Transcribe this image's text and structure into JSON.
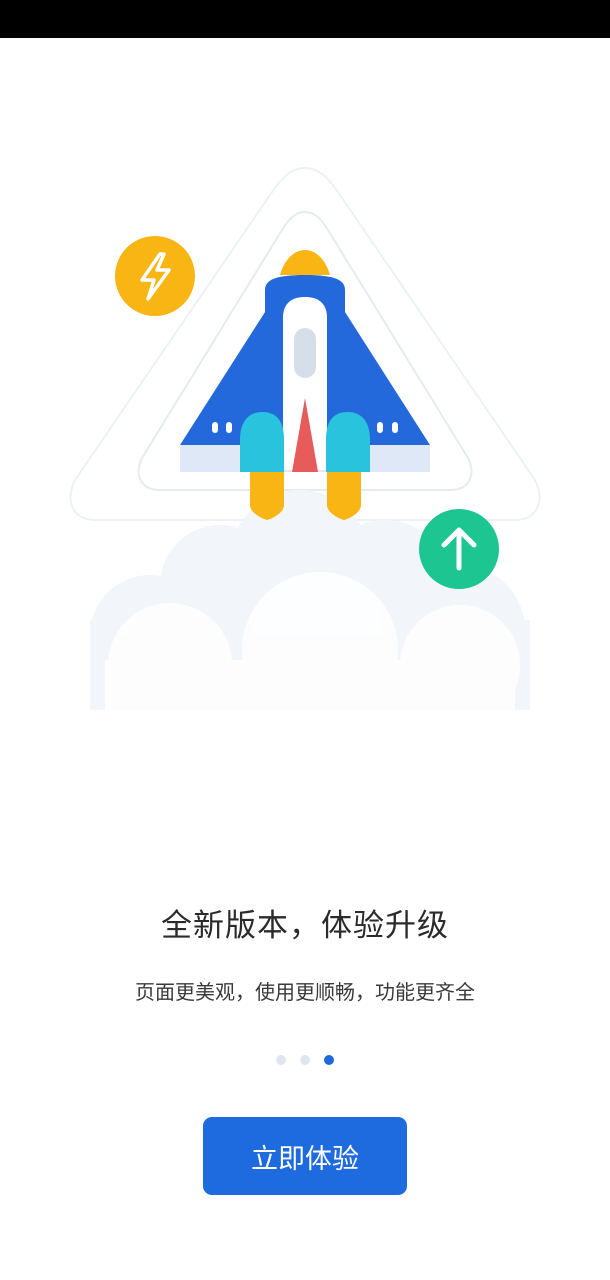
{
  "illustration": {
    "description_icon_left": "lightning-bolt-icon",
    "description_icon_right": "arrow-up-icon"
  },
  "onboarding": {
    "headline": "全新版本，体验升级",
    "subline": "页面更美观，使用更顺畅，功能更齐全",
    "page_indicator": {
      "total": 3,
      "active": 3
    },
    "cta_label": "立即体验"
  },
  "colors": {
    "accent": "#1e6be0",
    "rocket_blue": "#2369dc",
    "rocket_red": "#e85b5b",
    "flame_yellow": "#f8b514",
    "wing_cyan": "#29c3de",
    "badge_green": "#1dc591",
    "badge_yellow": "#f8b514"
  }
}
